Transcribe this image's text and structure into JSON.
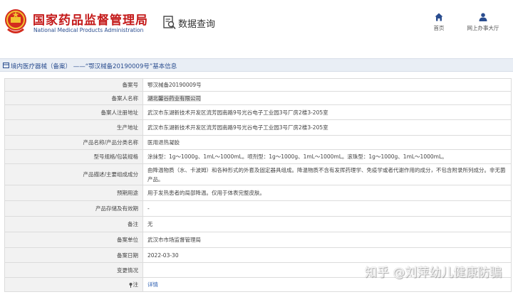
{
  "header": {
    "brand_cn": "国家药品监督管理局",
    "brand_en": "National Medical Products Administration",
    "query_title": "数据查询",
    "nav": [
      {
        "label": "首页",
        "icon": "home-icon"
      },
      {
        "label": "网上办事大厅",
        "icon": "user-icon"
      }
    ],
    "colors": {
      "brand": "#c41a1a",
      "accent": "#2a4d8f"
    }
  },
  "breadcrumb": {
    "text": "境内医疗器械（备案） ——“鄂汉械备20190009号”基本信息"
  },
  "rows": [
    {
      "label": "备案号",
      "value": "鄂汉械备20190009号"
    },
    {
      "label": "备案人名称",
      "value": "湖北馨谷药业有限公司"
    },
    {
      "label": "备案人注册地址",
      "value": "武汉市东湖新技术开发区流芳园南路9号光谷电子工业园3号厂房2楼3-205室"
    },
    {
      "label": "生产地址",
      "value": "武汉市东湖新技术开发区流芳园南路9号光谷电子工业园3号厂房2楼3-205室"
    },
    {
      "label": "产品名称/产品分类名称",
      "value": "医用退热凝胶"
    },
    {
      "label": "型号规格/包装规格",
      "value": "涂抹型：1g～1000g、1mL～1000mL。喷剂型：1g～1000g、1mL～1000mL。滚珠型：1g～1000g、1mL～1000mL。"
    },
    {
      "label": "产品描述/主要组成成分",
      "value": "由降温物质（水、卡波姆）和各种形式的外套及固定器具组成。降温物质不含有发挥药理学、免疫学或者代谢作用的成分，不包含附录所列成分。非无菌产品。"
    },
    {
      "label": "预期用途",
      "value": "用于发热患者的局部降温。仅用于体表完整皮肤。"
    },
    {
      "label": "产品存储及有效期",
      "value": "-"
    },
    {
      "label": "备注",
      "value": "无"
    },
    {
      "label": "备案单位",
      "value": "武汉市市场监督管理局"
    },
    {
      "label": "备案日期",
      "value": "2022-03-30"
    },
    {
      "label": "变更情况",
      "value": ""
    },
    {
      "label": "注",
      "value": "详情"
    }
  ],
  "watermark": "知乎 @刘萍幼儿健康防骗"
}
